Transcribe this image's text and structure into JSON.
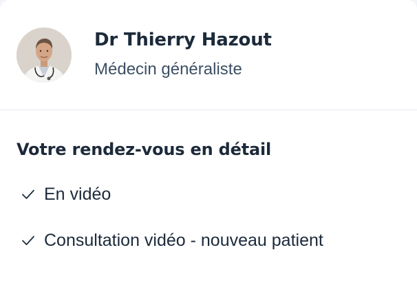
{
  "doctor": {
    "name": "Dr Thierry Hazout",
    "specialty": "Médecin généraliste",
    "avatar_icon": "doctor-portrait"
  },
  "details": {
    "title": "Votre rendez-vous en détail",
    "items": [
      {
        "icon": "check-icon",
        "label": "En vidéo"
      },
      {
        "icon": "check-icon",
        "label": "Consultation vidéo - nouveau patient"
      }
    ]
  },
  "colors": {
    "text_primary": "#1c2a3a",
    "text_secondary": "#3d4f63",
    "divider": "#e3e8ef",
    "background": "#ffffff"
  }
}
